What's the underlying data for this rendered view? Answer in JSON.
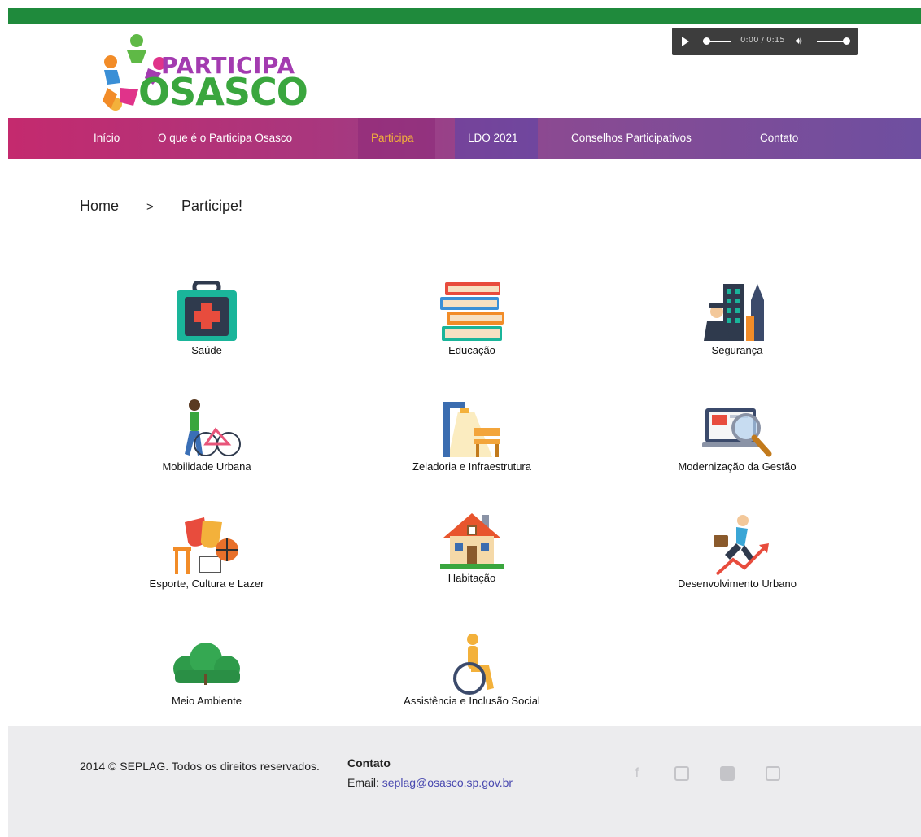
{
  "header": {
    "logo_top": "PARTICIPA",
    "logo_bottom": "OSASCO",
    "audio_time": "0:00 / 0:15"
  },
  "nav": {
    "items": [
      {
        "label": "Início"
      },
      {
        "label": "O que é o Participa Osasco"
      },
      {
        "label": "Participa"
      },
      {
        "label": "LDO 2021"
      },
      {
        "label": "Conselhos Participativos"
      },
      {
        "label": "Contato"
      }
    ],
    "active_color": "#f3b13b"
  },
  "breadcrumb": {
    "home": "Home",
    "separator": ">",
    "current": "Participe!"
  },
  "categories": [
    {
      "label": "Saúde",
      "icon": "medical-kit-icon"
    },
    {
      "label": "Educação",
      "icon": "books-icon"
    },
    {
      "label": "Segurança",
      "icon": "city-guard-icon"
    },
    {
      "label": "Mobilidade Urbana",
      "icon": "bicycle-walker-icon"
    },
    {
      "label": "Zeladoria e Infraestrutura",
      "icon": "streetlight-bench-icon"
    },
    {
      "label": "Modernização da Gestão",
      "icon": "laptop-magnifier-icon"
    },
    {
      "label": "Esporte, Cultura e Lazer",
      "icon": "masks-basketball-icon"
    },
    {
      "label": "Habitação",
      "icon": "house-icon"
    },
    {
      "label": "Desenvolvimento Urbano",
      "icon": "climbing-graph-icon"
    },
    {
      "label": "Meio Ambiente",
      "icon": "forest-icon"
    },
    {
      "label": "Assistência e Inclusão Social",
      "icon": "wheelchair-icon"
    }
  ],
  "footer": {
    "copyright": "2014 © SEPLAG. Todos os direitos reservados.",
    "contact_title": "Contato",
    "email_label": "Email:",
    "email": "seplag@osasco.sp.gov.br",
    "social": [
      "facebook-icon",
      "instagram-icon",
      "flickr-icon",
      "youtube-icon"
    ]
  }
}
